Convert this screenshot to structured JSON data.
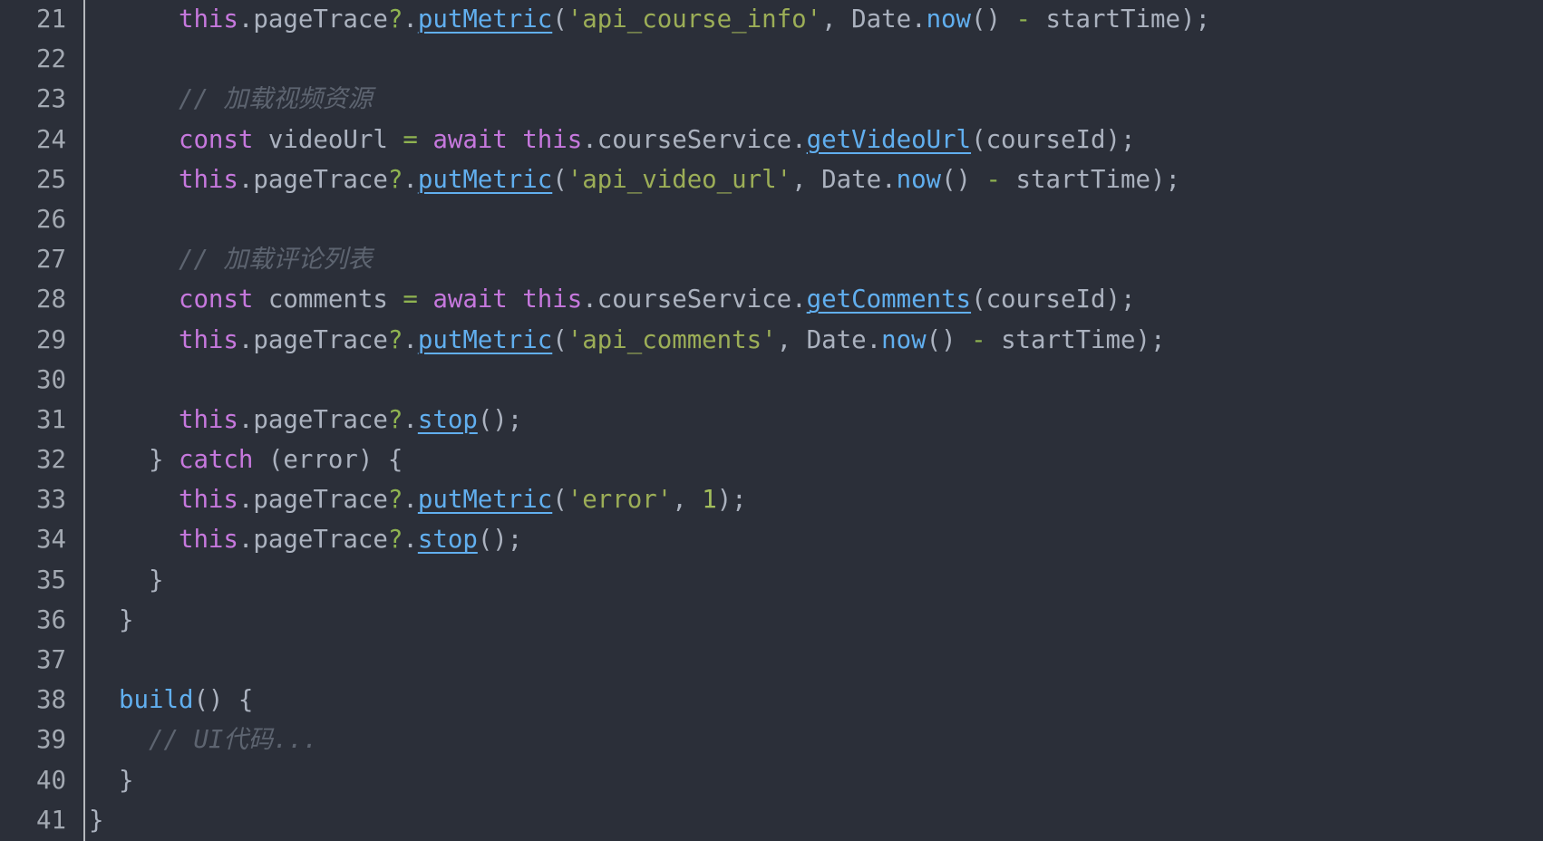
{
  "editor": {
    "kind": "code-editor-viewport",
    "background": "#2b2f39",
    "gutter_number_color": "#a3a9b2",
    "gutter_separator_color": "#b5b8bc",
    "palette": {
      "keyword": "#c678dd",
      "function": "#61afef",
      "identifier": "#abb2bf",
      "punct": "#abb2bf",
      "operator": "#8fb351",
      "string": "#9cae57",
      "number": "#a3be5c",
      "comment": "#5d6470"
    },
    "first_line_number": 21,
    "last_line_number": 41,
    "lines": [
      {
        "number": 21,
        "tokens": [
          [
            "ws",
            "      "
          ],
          [
            "kw",
            "this"
          ],
          [
            "pt",
            "."
          ],
          [
            "id",
            "pageTrace"
          ],
          [
            "op",
            "?"
          ],
          [
            "pt",
            "."
          ],
          [
            "fn",
            "putMetric",
            1
          ],
          [
            "pt",
            "("
          ],
          [
            "str",
            "'api_course_info'"
          ],
          [
            "pt",
            ", "
          ],
          [
            "id",
            "Date"
          ],
          [
            "pt",
            "."
          ],
          [
            "fn",
            "now"
          ],
          [
            "pt",
            "() "
          ],
          [
            "op",
            "-"
          ],
          [
            "ws",
            " "
          ],
          [
            "id",
            "startTime"
          ],
          [
            "pt",
            ");"
          ]
        ]
      },
      {
        "number": 22,
        "tokens": []
      },
      {
        "number": 23,
        "tokens": [
          [
            "ws",
            "      "
          ],
          [
            "cm",
            "// 加载视频资源"
          ]
        ]
      },
      {
        "number": 24,
        "tokens": [
          [
            "ws",
            "      "
          ],
          [
            "kw",
            "const"
          ],
          [
            "ws",
            " "
          ],
          [
            "id",
            "videoUrl"
          ],
          [
            "ws",
            " "
          ],
          [
            "op",
            "="
          ],
          [
            "ws",
            " "
          ],
          [
            "kw",
            "await"
          ],
          [
            "ws",
            " "
          ],
          [
            "kw",
            "this"
          ],
          [
            "pt",
            "."
          ],
          [
            "id",
            "courseService"
          ],
          [
            "pt",
            "."
          ],
          [
            "fn",
            "getVideoUrl",
            1
          ],
          [
            "pt",
            "("
          ],
          [
            "id",
            "courseId"
          ],
          [
            "pt",
            ");"
          ]
        ]
      },
      {
        "number": 25,
        "tokens": [
          [
            "ws",
            "      "
          ],
          [
            "kw",
            "this"
          ],
          [
            "pt",
            "."
          ],
          [
            "id",
            "pageTrace"
          ],
          [
            "op",
            "?"
          ],
          [
            "pt",
            "."
          ],
          [
            "fn",
            "putMetric",
            1
          ],
          [
            "pt",
            "("
          ],
          [
            "str",
            "'api_video_url'"
          ],
          [
            "pt",
            ", "
          ],
          [
            "id",
            "Date"
          ],
          [
            "pt",
            "."
          ],
          [
            "fn",
            "now"
          ],
          [
            "pt",
            "() "
          ],
          [
            "op",
            "-"
          ],
          [
            "ws",
            " "
          ],
          [
            "id",
            "startTime"
          ],
          [
            "pt",
            ");"
          ]
        ]
      },
      {
        "number": 26,
        "tokens": []
      },
      {
        "number": 27,
        "tokens": [
          [
            "ws",
            "      "
          ],
          [
            "cm",
            "// 加载评论列表"
          ]
        ]
      },
      {
        "number": 28,
        "tokens": [
          [
            "ws",
            "      "
          ],
          [
            "kw",
            "const"
          ],
          [
            "ws",
            " "
          ],
          [
            "id",
            "comments"
          ],
          [
            "ws",
            " "
          ],
          [
            "op",
            "="
          ],
          [
            "ws",
            " "
          ],
          [
            "kw",
            "await"
          ],
          [
            "ws",
            " "
          ],
          [
            "kw",
            "this"
          ],
          [
            "pt",
            "."
          ],
          [
            "id",
            "courseService"
          ],
          [
            "pt",
            "."
          ],
          [
            "fn",
            "getComments",
            1
          ],
          [
            "pt",
            "("
          ],
          [
            "id",
            "courseId"
          ],
          [
            "pt",
            ");"
          ]
        ]
      },
      {
        "number": 29,
        "tokens": [
          [
            "ws",
            "      "
          ],
          [
            "kw",
            "this"
          ],
          [
            "pt",
            "."
          ],
          [
            "id",
            "pageTrace"
          ],
          [
            "op",
            "?"
          ],
          [
            "pt",
            "."
          ],
          [
            "fn",
            "putMetric",
            1
          ],
          [
            "pt",
            "("
          ],
          [
            "str",
            "'api_comments'"
          ],
          [
            "pt",
            ", "
          ],
          [
            "id",
            "Date"
          ],
          [
            "pt",
            "."
          ],
          [
            "fn",
            "now"
          ],
          [
            "pt",
            "() "
          ],
          [
            "op",
            "-"
          ],
          [
            "ws",
            " "
          ],
          [
            "id",
            "startTime"
          ],
          [
            "pt",
            ");"
          ]
        ]
      },
      {
        "number": 30,
        "tokens": []
      },
      {
        "number": 31,
        "tokens": [
          [
            "ws",
            "      "
          ],
          [
            "kw",
            "this"
          ],
          [
            "pt",
            "."
          ],
          [
            "id",
            "pageTrace"
          ],
          [
            "op",
            "?"
          ],
          [
            "pt",
            "."
          ],
          [
            "fn",
            "stop",
            1
          ],
          [
            "pt",
            "();"
          ]
        ]
      },
      {
        "number": 32,
        "tokens": [
          [
            "ws",
            "    "
          ],
          [
            "pt",
            "} "
          ],
          [
            "kw",
            "catch"
          ],
          [
            "pt",
            " ("
          ],
          [
            "id",
            "error"
          ],
          [
            "pt",
            ") {"
          ]
        ]
      },
      {
        "number": 33,
        "tokens": [
          [
            "ws",
            "      "
          ],
          [
            "kw",
            "this"
          ],
          [
            "pt",
            "."
          ],
          [
            "id",
            "pageTrace"
          ],
          [
            "op",
            "?"
          ],
          [
            "pt",
            "."
          ],
          [
            "fn",
            "putMetric",
            1
          ],
          [
            "pt",
            "("
          ],
          [
            "str",
            "'error'"
          ],
          [
            "pt",
            ", "
          ],
          [
            "num",
            "1"
          ],
          [
            "pt",
            ");"
          ]
        ]
      },
      {
        "number": 34,
        "tokens": [
          [
            "ws",
            "      "
          ],
          [
            "kw",
            "this"
          ],
          [
            "pt",
            "."
          ],
          [
            "id",
            "pageTrace"
          ],
          [
            "op",
            "?"
          ],
          [
            "pt",
            "."
          ],
          [
            "fn",
            "stop",
            1
          ],
          [
            "pt",
            "();"
          ]
        ]
      },
      {
        "number": 35,
        "tokens": [
          [
            "ws",
            "    "
          ],
          [
            "pt",
            "}"
          ]
        ]
      },
      {
        "number": 36,
        "tokens": [
          [
            "ws",
            "  "
          ],
          [
            "pt",
            "}"
          ]
        ]
      },
      {
        "number": 37,
        "tokens": []
      },
      {
        "number": 38,
        "tokens": [
          [
            "ws",
            "  "
          ],
          [
            "fn",
            "build"
          ],
          [
            "pt",
            "() {"
          ]
        ]
      },
      {
        "number": 39,
        "tokens": [
          [
            "ws",
            "    "
          ],
          [
            "cm",
            "// UI代码..."
          ]
        ]
      },
      {
        "number": 40,
        "tokens": [
          [
            "ws",
            "  "
          ],
          [
            "pt",
            "}"
          ]
        ]
      },
      {
        "number": 41,
        "tokens": [
          [
            "pt",
            "}"
          ]
        ]
      }
    ]
  }
}
